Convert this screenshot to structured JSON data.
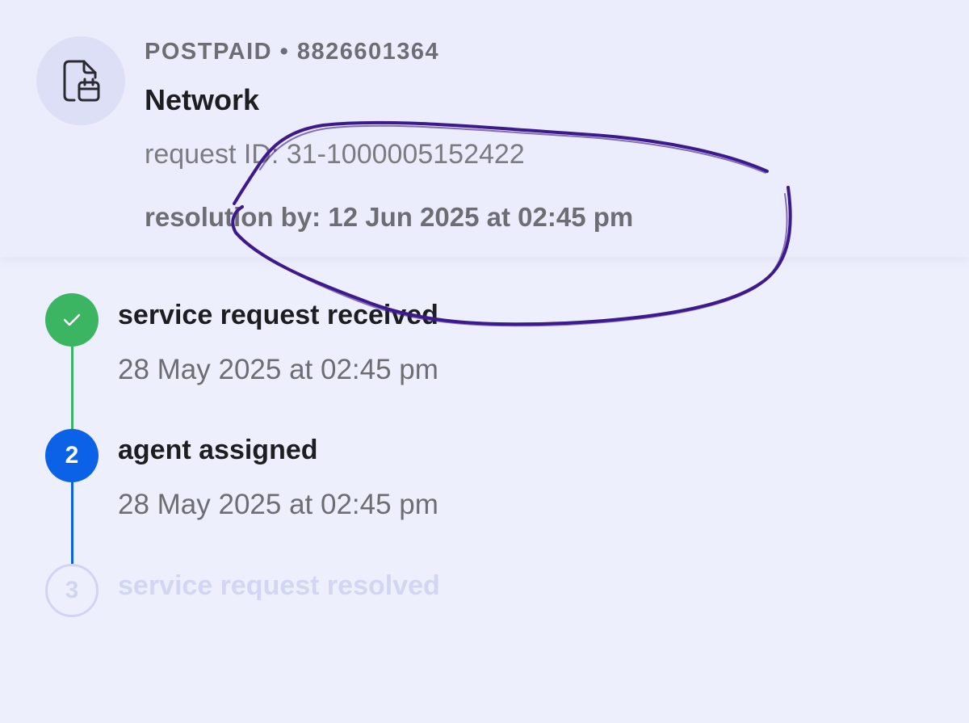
{
  "request": {
    "account_line": "POSTPAID • 8826601364",
    "service_title": "Network",
    "request_id": "request ID: 31-1000005152422",
    "resolution": "resolution by: 12 Jun 2025 at 02:45 pm",
    "icon": "document-calendar-icon"
  },
  "timeline": {
    "steps": [
      {
        "marker": "check-icon",
        "status": "completed",
        "title": "service request received",
        "time": "28 May 2025 at 02:45 pm"
      },
      {
        "marker": "2",
        "status": "in-progress",
        "title": "agent assigned",
        "time": "28 May 2025 at 02:45 pm"
      },
      {
        "marker": "3",
        "status": "pending",
        "title": "service request resolved",
        "time": ""
      }
    ]
  },
  "colors": {
    "background": "#eeeffd",
    "completed": "#3cb563",
    "active": "#0b62e6",
    "pending": "#d1d5f1",
    "annotation_ink": "#3d1a8c"
  }
}
